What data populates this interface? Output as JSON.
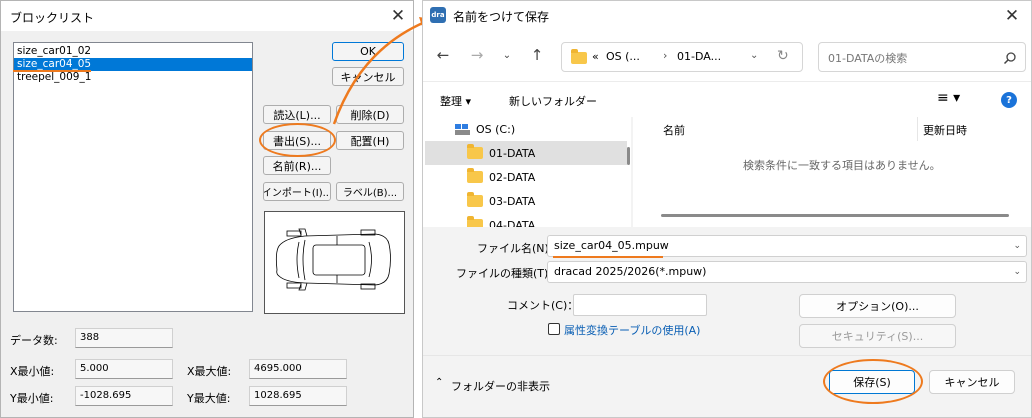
{
  "block_dialog": {
    "title": "ブロックリスト",
    "list_items": [
      "size_car01_02",
      "size_car04_05",
      "treepel_009_1"
    ],
    "selected_index": 1,
    "buttons": {
      "ok": "OK",
      "cancel": "キャンセル",
      "load": "読込(L)...",
      "delete": "削除(D)",
      "export": "書出(S)...",
      "place": "配置(H)",
      "rename": "名前(R)...",
      "import": "インポート(I)...",
      "label": "ラベル(B)..."
    },
    "stats": {
      "data_count_label": "データ数:",
      "data_count": "388",
      "xmin_label": "X最小値:",
      "xmin": "5.000",
      "xmax_label": "X最大値:",
      "xmax": "4695.000",
      "ymin_label": "Y最小値:",
      "ymin": "-1028.695",
      "ymax_label": "Y最大値:",
      "ymax": "1028.695"
    }
  },
  "save_dialog": {
    "app_icon_text": "dra",
    "title": "名前をつけて保存",
    "path": {
      "sep": "«",
      "seg1": "OS (...",
      "seg2": "01-DA..."
    },
    "search_placeholder": "01-DATAの検索",
    "toolbar": {
      "organize": "整理",
      "new_folder": "新しいフォルダー"
    },
    "tree": [
      {
        "label": "OS (C:)",
        "type": "drive"
      },
      {
        "label": "01-DATA",
        "type": "folder",
        "selected": true
      },
      {
        "label": "02-DATA",
        "type": "folder"
      },
      {
        "label": "03-DATA",
        "type": "folder"
      },
      {
        "label": "04-DATA",
        "type": "folder"
      }
    ],
    "columns": {
      "name": "名前",
      "modified": "更新日時"
    },
    "empty_message": "検索条件に一致する項目はありません。",
    "filename_label": "ファイル名(N):",
    "filename_value": "size_car04_05.mpuw",
    "filetype_label": "ファイルの種類(T):",
    "filetype_value": "dracad 2025/2026(*.mpuw)",
    "comment_label": "コメント(C)：",
    "comment_value": "",
    "checkbox_label": "属性変換テーブルの使用(A)",
    "checkbox_checked": false,
    "options_button": "オプション(O)...",
    "security_button": "セキュリティ(S)...",
    "hide_folders": "フォルダーの非表示",
    "save_button": "保存(S)",
    "cancel_button": "キャンセル"
  },
  "colors": {
    "highlight_orange": "#ee7a1e",
    "selection_blue": "#0078d7",
    "link_blue": "#0a5fb4"
  },
  "icons": [
    "close-icon",
    "back-arrow-icon",
    "forward-arrow-icon",
    "chevron-down-icon",
    "up-arrow-icon",
    "folder-icon",
    "refresh-icon",
    "search-icon",
    "view-icon",
    "help-icon",
    "drive-icon",
    "chevron-up-icon"
  ]
}
